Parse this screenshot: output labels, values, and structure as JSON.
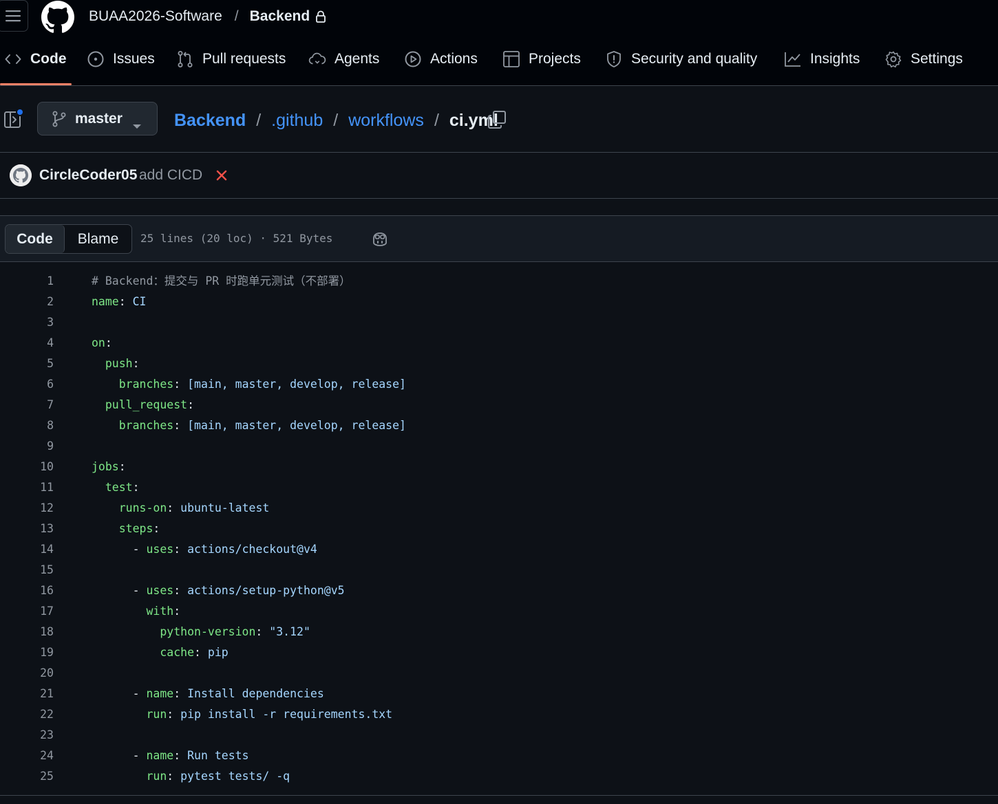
{
  "header": {
    "owner": "BUAA2026-Software",
    "separator": "/",
    "repo": "Backend"
  },
  "nav": {
    "tabs": [
      {
        "label": "Code",
        "icon": "code-icon",
        "selected": true
      },
      {
        "label": "Issues",
        "icon": "issue-opened-icon"
      },
      {
        "label": "Pull requests",
        "icon": "git-pull-request-icon"
      },
      {
        "label": "Agents",
        "icon": "agent-icon"
      },
      {
        "label": "Actions",
        "icon": "play-icon"
      },
      {
        "label": "Projects",
        "icon": "table-icon"
      },
      {
        "label": "Security and quality",
        "icon": "shield-icon"
      },
      {
        "label": "Insights",
        "icon": "graph-icon"
      },
      {
        "label": "Settings",
        "icon": "gear-icon"
      }
    ]
  },
  "filebar": {
    "branch": "master",
    "path": [
      ".github",
      "workflows"
    ],
    "repo_link": "Backend",
    "file": "ci.yml",
    "sep": "/"
  },
  "commit": {
    "author": "CircleCoder05",
    "message": "add CICD",
    "status": "failure"
  },
  "viewer": {
    "tab_code": "Code",
    "tab_blame": "Blame",
    "info": "25 lines (20 loc) · 521 Bytes"
  },
  "code": {
    "lines": [
      "# Backend：提交与 PR 时跑单元测试（不部署）",
      "name: CI",
      "",
      "on:",
      "  push:",
      "    branches: [main, master, develop, release]",
      "  pull_request:",
      "    branches: [main, master, develop, release]",
      "",
      "jobs:",
      "  test:",
      "    runs-on: ubuntu-latest",
      "    steps:",
      "      - uses: actions/checkout@v4",
      "",
      "      - uses: actions/setup-python@v5",
      "        with:",
      "          python-version: \"3.12\"",
      "          cache: pip",
      "",
      "      - name: Install dependencies",
      "        run: pip install -r requirements.txt",
      "",
      "      - name: Run tests",
      "        run: pytest tests/ -q"
    ]
  },
  "colors": {
    "background": "#0d1117",
    "header": "#010409",
    "accent_underline": "#f78166",
    "link": "#4493f8",
    "yaml_key": "#7ee787",
    "yaml_value": "#a5d6ff",
    "comment": "#9198a1",
    "failure": "#f85149"
  }
}
